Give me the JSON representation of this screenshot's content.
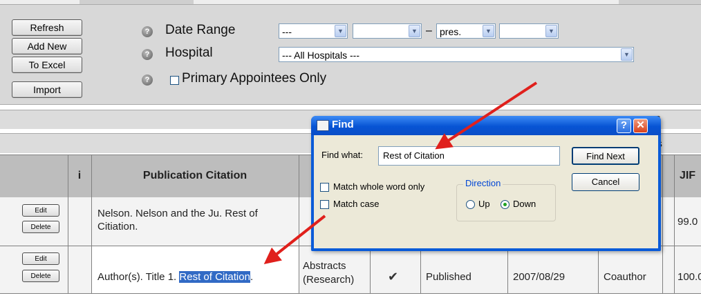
{
  "toolbar": {
    "buttons": [
      "Refresh",
      "Add New",
      "To Excel",
      "Import"
    ]
  },
  "filters": {
    "help_glyph": "?",
    "date_range_label": "Date Range",
    "date_from_value": "---",
    "date_to_value": "pres.",
    "date_separator": "–",
    "hospital_label": "Hospital",
    "hospital_value": "--- All Hospitals ---",
    "primary_appointees_label": "Primary Appointees Only"
  },
  "bars": {
    "bar1_text": "s",
    "bar2_text": "ns"
  },
  "table": {
    "headers": {
      "info": "i",
      "citation": "Publication Citation",
      "jif": "JIF"
    },
    "edit_label": "Edit",
    "delete_label": "Delete",
    "rows": [
      {
        "citation": "Nelson. Nelson and the Ju. Rest of Citiation.",
        "jif": "99.0"
      },
      {
        "citation_before": "Author(s). Title 1.",
        "citation_highlight": "Rest of Citation",
        "citation_after": ".",
        "type": "Abstracts (Research)",
        "checkmark": "✔",
        "status": "Published",
        "date": "2007/08/29",
        "role": "Coauthor",
        "jif": "100.0"
      }
    ]
  },
  "find_dialog": {
    "title": "Find",
    "help_button": "?",
    "close_button": "✕",
    "find_what_label": "Find what:",
    "find_what_value": "Rest of Citation",
    "find_next_label": "Find Next",
    "cancel_label": "Cancel",
    "match_whole_word_label": "Match whole word only",
    "match_case_label": "Match case",
    "direction_label": "Direction",
    "direction_options": [
      "Up",
      "Down"
    ],
    "direction_selected": "Down"
  },
  "colors": {
    "arrow": "#e0201c",
    "dialog_titlebar": "#0754d4",
    "selection": "#316ac5"
  }
}
